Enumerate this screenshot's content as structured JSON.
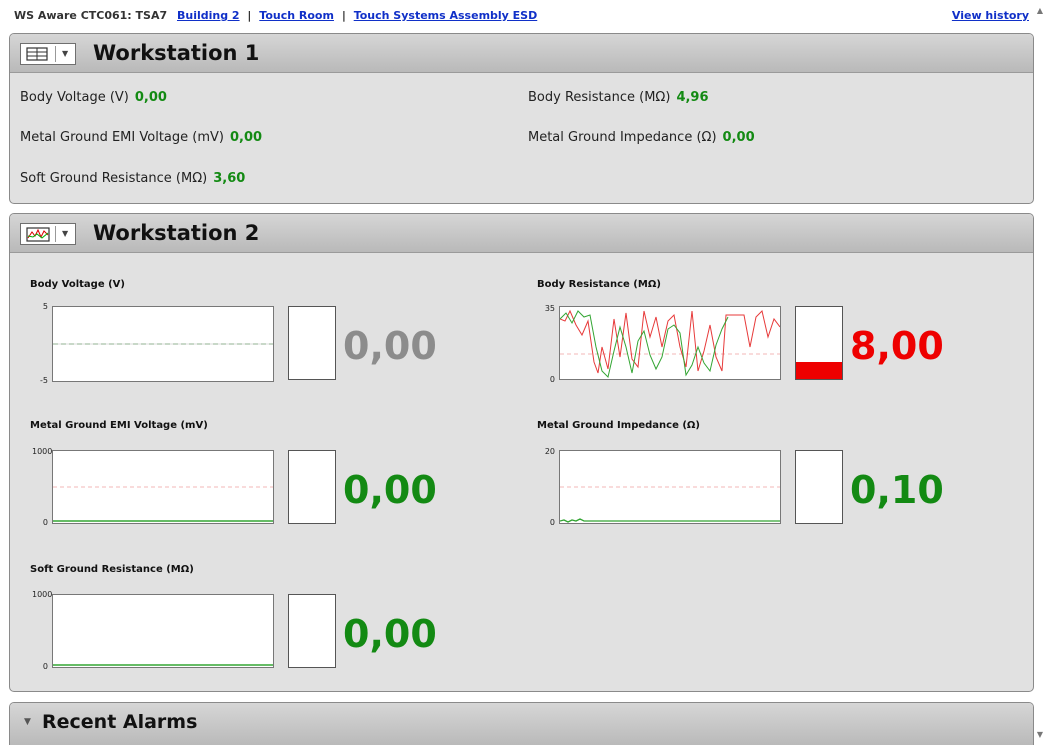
{
  "header": {
    "prefix": "WS Aware CTC061: TSA7",
    "breadcrumbs": [
      "Building 2",
      "Touch Room",
      "Touch Systems Assembly ESD"
    ],
    "separator": "|",
    "view_history": "View history"
  },
  "workstation1": {
    "title": "Workstation 1",
    "icon": "table-view-icon",
    "fields": [
      {
        "label": "Body Voltage (V)",
        "value": "0,00"
      },
      {
        "label": "Body Resistance (MΩ)",
        "value": "4,96"
      },
      {
        "label": "Metal Ground EMI Voltage (mV)",
        "value": "0,00"
      },
      {
        "label": "Metal Ground Impedance (Ω)",
        "value": "0,00"
      },
      {
        "label": "Soft Ground Resistance (MΩ)",
        "value": "3,60"
      }
    ]
  },
  "workstation2": {
    "title": "Workstation 2",
    "icon": "chart-view-icon",
    "metrics": [
      {
        "label": "Body Voltage (V)",
        "value": "0,00",
        "ymax": "5",
        "ymin": "-5",
        "status": "idle",
        "color": "#8c8c8c",
        "level": 0
      },
      {
        "label": "Body Resistance (MΩ)",
        "value": "8,00",
        "ymax": "35",
        "ymin": "0",
        "status": "alarm",
        "color": "#ee0000",
        "level": 0.23
      },
      {
        "label": "Metal Ground EMI Voltage (mV)",
        "value": "0,00",
        "ymax": "1000",
        "ymin": "0",
        "status": "ok",
        "color": "#138a13",
        "level": 0
      },
      {
        "label": "Metal Ground Impedance (Ω)",
        "value": "0,10",
        "ymax": "20",
        "ymin": "0",
        "status": "ok",
        "color": "#138a13",
        "level": 0
      },
      {
        "label": "Soft Ground Resistance (MΩ)",
        "value": "0,00",
        "ymax": "1000",
        "ymin": "0",
        "status": "ok",
        "color": "#138a13",
        "level": 0
      }
    ]
  },
  "alarms": {
    "title": "Recent Alarms"
  }
}
